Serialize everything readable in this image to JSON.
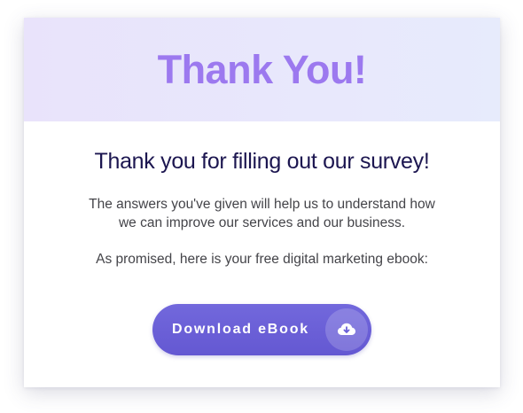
{
  "header": {
    "title": "Thank You!"
  },
  "main": {
    "heading": "Thank you for filling out our survey!",
    "paragraph_1_line_1": "The answers you've given will help us to understand how",
    "paragraph_1_line_2": "we can improve our services and our business.",
    "paragraph_2": "As promised, here is your free digital marketing ebook:"
  },
  "download_button": {
    "label": "Download eBook",
    "icon": "cloud-download-icon"
  },
  "colors": {
    "title": "#9c79ef",
    "heading": "#1c1650",
    "button": "#6a5fd8",
    "header_background": "#e9e3fb"
  }
}
